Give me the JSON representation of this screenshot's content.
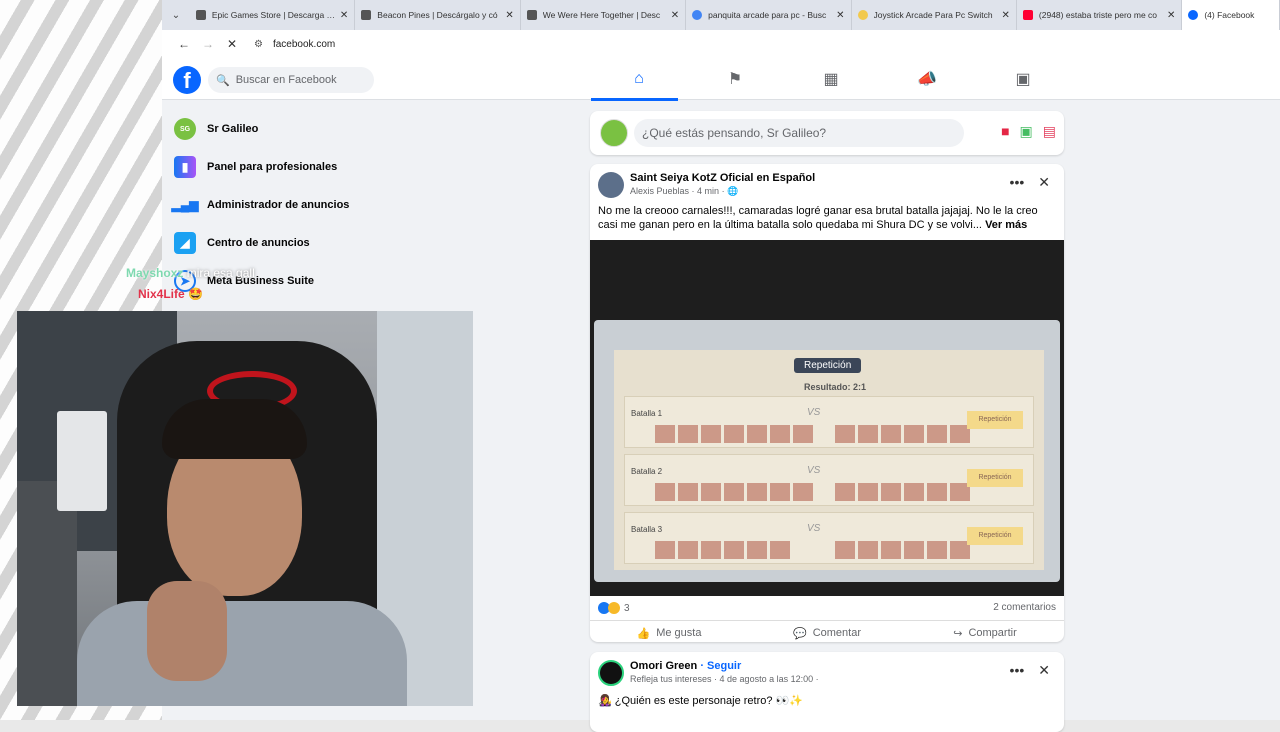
{
  "browser": {
    "tabs": [
      {
        "title": "Epic Games Store | Descarga y d",
        "color": "#555555"
      },
      {
        "title": "Beacon Pines | Descárgalo y có",
        "color": "#555555"
      },
      {
        "title": "We Were Here Together | Desc",
        "color": "#555555"
      },
      {
        "title": "panquita arcade para pc - Busc",
        "color": "#4285f4"
      },
      {
        "title": "Joystick Arcade Para Pc Switch",
        "color": "#f2c94c"
      },
      {
        "title": "(2948) estaba triste pero me co",
        "color": "#ff0033"
      },
      {
        "title": "(4) Facebook",
        "color": "#0866ff"
      }
    ],
    "url": "facebook.com"
  },
  "fb": {
    "logo": "f",
    "search_placeholder": "Buscar en Facebook",
    "nav_icons": [
      "home-icon",
      "flag-icon",
      "pages-icon",
      "megaphone-icon",
      "video-icon"
    ],
    "sidebar": [
      {
        "label": "Sr Galileo",
        "icon": "avatar"
      },
      {
        "label": "Panel para profesionales",
        "icon": "chart-icon"
      },
      {
        "label": "Administrador de anuncios",
        "icon": "bar-chart-icon"
      },
      {
        "label": "Centro de anuncios",
        "icon": "ads-icon"
      },
      {
        "label": "Meta Business Suite",
        "icon": "business-icon"
      }
    ],
    "composer_placeholder": "¿Qué estás pensando, Sr Galileo?",
    "post1": {
      "page": "Saint Seiya KotZ Oficial en Español",
      "author": "Alexis Pueblas",
      "time": "4 min",
      "text": "No me la creooo carnales!!!, camaradas logré ganar esa brutal batalla jajajaj. No le la creo casi me ganan pero en la última batalla solo quedaba mi Shura DC y se volvi...",
      "more": "Ver más",
      "game_title": "Repetición",
      "game_result": "Resultado: 2:1",
      "battles": [
        "Batalla 1",
        "Batalla 2",
        "Batalla 3"
      ],
      "replay": "Repetición",
      "vs": "VS",
      "reactions_count": "3",
      "comments": "2 comentarios",
      "actions": [
        "Me gusta",
        "Comentar",
        "Compartir"
      ]
    },
    "post2": {
      "page": "Omori Green",
      "follow": "· Seguir",
      "meta": "Refleja tus intereses · 4 de agosto a las 12:00 ·",
      "text": "👩‍🎤 ¿Quién es este personaje retro? 👀✨"
    }
  },
  "stream": {
    "chat1_user": "Mayshoxz",
    "chat1_msg": "mira esa gall",
    "chat2_user": "Nix4Life",
    "chat2_emoji": "🤩"
  }
}
